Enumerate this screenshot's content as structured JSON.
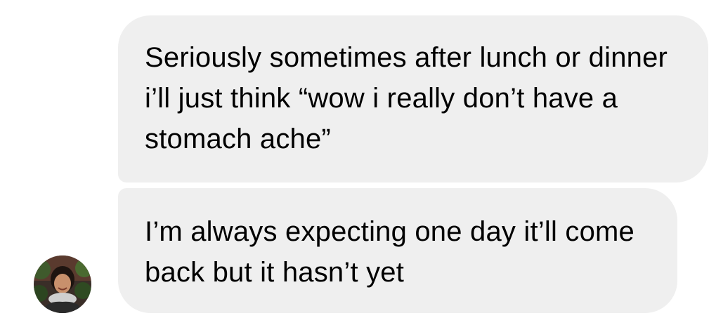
{
  "messages": [
    {
      "text": "Seriously sometimes after lunch or dinner i’ll just think “wow i really don’t have a stomach ache”"
    },
    {
      "text": "I’m always expecting one day it’ll come back but it hasn’t yet"
    }
  ],
  "colors": {
    "bubble_background": "#efefef",
    "text": "#000000",
    "background": "#ffffff"
  }
}
